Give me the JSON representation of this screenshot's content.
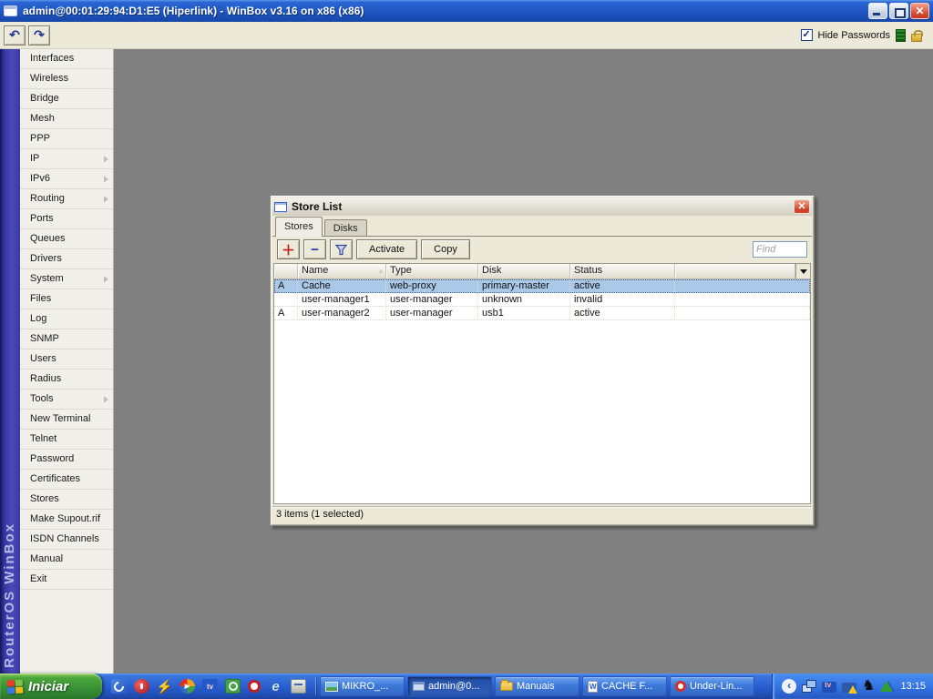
{
  "titlebar": {
    "title": "admin@00:01:29:94:D1:E5 (Hiperlink) - WinBox v3.16 on x86 (x86)"
  },
  "toolbar": {
    "hide_passwords_label": "Hide Passwords",
    "hide_passwords_checked": true,
    "icons": [
      "undo-icon",
      "redo-icon",
      "traffic-indicator-icon",
      "padlock-icon"
    ]
  },
  "sidebar": {
    "brand": "RouterOS WinBox",
    "items": [
      {
        "label": "Interfaces",
        "submenu": false
      },
      {
        "label": "Wireless",
        "submenu": false
      },
      {
        "label": "Bridge",
        "submenu": false
      },
      {
        "label": "Mesh",
        "submenu": false
      },
      {
        "label": "PPP",
        "submenu": false
      },
      {
        "label": "IP",
        "submenu": true
      },
      {
        "label": "IPv6",
        "submenu": true
      },
      {
        "label": "Routing",
        "submenu": true
      },
      {
        "label": "Ports",
        "submenu": false
      },
      {
        "label": "Queues",
        "submenu": false
      },
      {
        "label": "Drivers",
        "submenu": false
      },
      {
        "label": "System",
        "submenu": true
      },
      {
        "label": "Files",
        "submenu": false
      },
      {
        "label": "Log",
        "submenu": false
      },
      {
        "label": "SNMP",
        "submenu": false
      },
      {
        "label": "Users",
        "submenu": false
      },
      {
        "label": "Radius",
        "submenu": false
      },
      {
        "label": "Tools",
        "submenu": true
      },
      {
        "label": "New Terminal",
        "submenu": false
      },
      {
        "label": "Telnet",
        "submenu": false
      },
      {
        "label": "Password",
        "submenu": false
      },
      {
        "label": "Certificates",
        "submenu": false
      },
      {
        "label": "Stores",
        "submenu": false
      },
      {
        "label": "Make Supout.rif",
        "submenu": false
      },
      {
        "label": "ISDN Channels",
        "submenu": false
      },
      {
        "label": "Manual",
        "submenu": false
      },
      {
        "label": "Exit",
        "submenu": false
      }
    ]
  },
  "store_list": {
    "title": "Store List",
    "tabs": [
      {
        "label": "Stores",
        "active": true
      },
      {
        "label": "Disks",
        "active": false
      }
    ],
    "toolbar": {
      "activate_label": "Activate",
      "copy_label": "Copy",
      "find_placeholder": "Find",
      "icons": [
        "add-icon",
        "remove-icon",
        "filter-funnel-icon"
      ]
    },
    "table": {
      "columns": {
        "flag": "",
        "name": "Name",
        "type": "Type",
        "disk": "Disk",
        "status": "Status"
      },
      "sort_column": "Name",
      "rows": [
        {
          "flag": "A",
          "name": "Cache",
          "type": "web-proxy",
          "disk": "primary-master",
          "status": "active",
          "selected": true
        },
        {
          "flag": "",
          "name": "user-manager1",
          "type": "user-manager",
          "disk": "unknown",
          "status": "invalid",
          "selected": false
        },
        {
          "flag": "A",
          "name": "user-manager2",
          "type": "user-manager",
          "disk": "usb1",
          "status": "active",
          "selected": false
        }
      ]
    },
    "status_text": "3 items (1 selected)"
  },
  "taskbar": {
    "start_label": "Iniciar",
    "quick_launch_icons": [
      "msn-swirl-icon",
      "media-player-red-icon",
      "winamp-lightning-icon",
      "windows-media-player-icon",
      "tv-app-icon",
      "desktop-search-icon",
      "opera-ring-icon",
      "internet-explorer-icon",
      "show-desktop-icon"
    ],
    "tasks": [
      {
        "label": "MIKRO_...",
        "icon": "image-file-icon",
        "active": false
      },
      {
        "label": "admin@0...",
        "icon": "winbox-window-icon",
        "active": true
      },
      {
        "label": "Manuais",
        "icon": "folder-icon",
        "active": false
      },
      {
        "label": "CACHE F...",
        "icon": "word-document-icon",
        "active": false
      },
      {
        "label": "Under-Lin...",
        "icon": "opera-icon",
        "active": false
      }
    ],
    "tray_icons": [
      "collapse-chevron-icon",
      "network-connections-icon",
      "tv-tuner-icon",
      "network-warning-icon",
      "animal-silhouette-icon",
      "triangle-logo-icon"
    ],
    "clock": "13:15"
  },
  "colors": {
    "desktop": "#808080",
    "selection_blue": "#aac8e8",
    "titlebar_blue": "#1e56c2",
    "taskbar_blue": "#2a5fd0",
    "start_green": "#389036",
    "dialog_face": "#ece9d8",
    "sidebar_strip_blue": "#3a3aa8"
  }
}
